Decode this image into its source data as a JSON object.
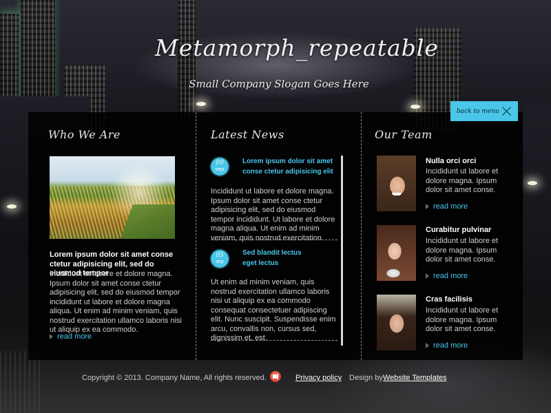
{
  "header": {
    "title": "Metamorph_repeatable",
    "slogan": "Small Company Slogan Goes Here",
    "back_button_label": "back to menu"
  },
  "who_we_are": {
    "title": "Who We Are",
    "lead": "Lorem ipsum dolor sit amet conse ctetur adipisicing elit, sed do eiusmod tempor",
    "body": "Incididunt ut labore et dolore magna. Ipsum dolor sit amet conse ctetur adipisicing elit, sed do eiusmod tempor incididunt ut labore et dolore magna aliqua. Ut enim ad minim veniam, quis nostrud exercitation ullamco laboris nisi ut aliquip ex ea commodo.",
    "more_label": "read more"
  },
  "latest_news": {
    "title": "Latest News",
    "items": [
      {
        "day": "09",
        "month": "sept",
        "title_line1": "Lorem ipsum dolor sit amet",
        "title_line2": "conse ctetur adipisicing elit",
        "body": "Incididunt ut labore et dolore magna. Ipsum dolor sit amet conse ctetur adipisicing elit, sed do eiusmod tempor incididunt. Ut labore et dolore magna aliqua. Ut enim ad minim veniam, quis nostrud exercitation."
      },
      {
        "day": "05",
        "month": "sep",
        "title_line1": "Sed blandit lectus",
        "title_line2": "eget lectus",
        "body": "Ut enim ad minim veniam, quis nostrud exercitation ullamco laboris nisi ut aliquip ex ea commodo consequat consectetuer adipiscing elit. Nunc suscipit. Suspendisse enim arcu, convallis non, cursus sed, dignissim et, est."
      }
    ]
  },
  "our_team": {
    "title": "Our Team",
    "members": [
      {
        "name": "Nulla orci orci",
        "text": "Incididunt ut labore et dolore magna. Ipsum dolor sit amet conse.",
        "more_label": "read more"
      },
      {
        "name": "Curabitur pulvinar",
        "text": "Incididunt ut labore et dolore magna. Ipsum dolor sit amet conse.",
        "more_label": "read more"
      },
      {
        "name": "Cras facilisis",
        "text": "Incididunt ut labore et dolore magna. Ipsum dolor sit amet conse.",
        "more_label": "read more"
      }
    ]
  },
  "footer": {
    "copyright": "Copyright © 2013. Company Name, All rights reserved.",
    "privacy_label": "Privacy policy",
    "design_by": "Design by",
    "design_link": "Website Templates"
  },
  "icons": {
    "back": "close-icon",
    "sound": "speaker-icon",
    "more": "arrow-right-icon"
  },
  "colors": {
    "accent": "#49c6e8",
    "panel": "#000000",
    "text": "#d0d0d0"
  }
}
